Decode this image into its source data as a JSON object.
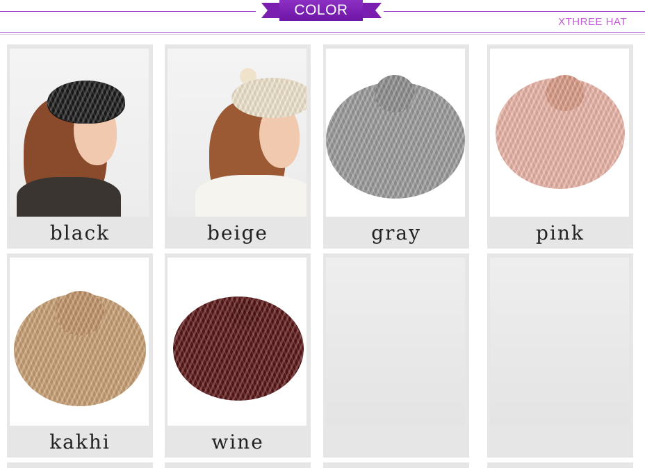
{
  "header": {
    "title": "COLOR",
    "brand": "XTHREE HAT"
  },
  "colors": {
    "accent_purple": "#7b1fb0",
    "brand_text": "#c25bd8",
    "card_bg": "#e6e6e6"
  },
  "swatches": [
    {
      "label": "black",
      "hat_color": "#1a1a1a"
    },
    {
      "label": "beige",
      "hat_color": "#efe3cc"
    },
    {
      "label": "gray",
      "hat_color": "#9a9a9a"
    },
    {
      "label": "pink",
      "hat_color": "#e9b3a6"
    },
    {
      "label": "kakhi",
      "hat_color": "#c79e72"
    },
    {
      "label": "wine",
      "hat_color": "#5a1616"
    },
    {
      "label": "",
      "hat_color": ""
    },
    {
      "label": "",
      "hat_color": ""
    }
  ]
}
